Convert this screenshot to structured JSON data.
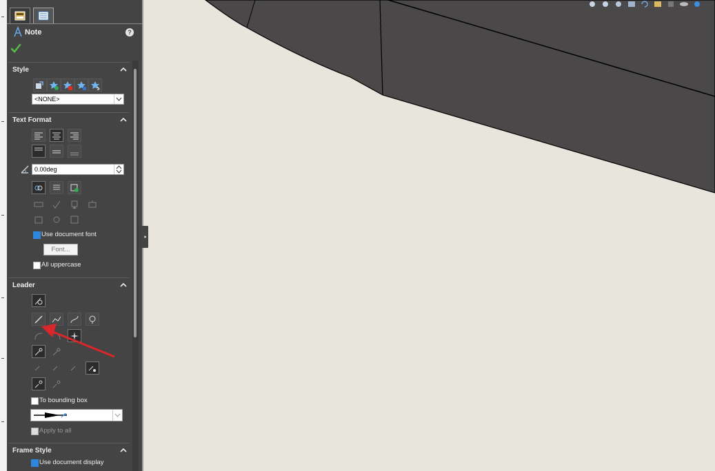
{
  "panel": {
    "title": "Note",
    "help_glyph": "?",
    "tabs": [
      {
        "name": "property-manager-tab",
        "icon": "property-manager-icon"
      },
      {
        "name": "feature-tree-tab",
        "icon": "feature-tree-icon"
      }
    ]
  },
  "sections": {
    "style": {
      "title": "Style",
      "style_select": "<NONE>"
    },
    "text_format": {
      "title": "Text Format",
      "angle_value": "0.00deg",
      "use_document_font": "Use document font",
      "font_button": "Font...",
      "all_uppercase": "All uppercase"
    },
    "leader": {
      "title": "Leader",
      "to_bounding_box": "To bounding box",
      "apply_to_all": "Apply to all"
    },
    "frame_style": {
      "title": "Frame Style",
      "use_document_display": "Use document display"
    }
  },
  "checkboxes": {
    "use_document_font": true,
    "all_uppercase": false,
    "to_bounding_box": false,
    "apply_to_all": false,
    "use_document_display": true
  },
  "canvas": {
    "help_glyph": "?"
  },
  "colors": {
    "panel_bg": "#444444",
    "canvas_bg": "#e8e5dc",
    "part_face": "#4a4848",
    "accent_blue": "#2f86de",
    "annotation_red": "#d9262b"
  }
}
